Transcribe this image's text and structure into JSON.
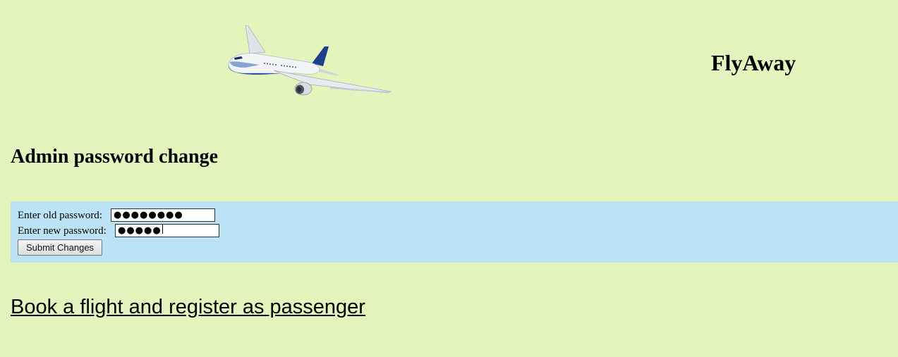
{
  "header": {
    "logo_icon": "airplane-icon",
    "brand": "FlyAway"
  },
  "page": {
    "title": "Admin password change"
  },
  "form": {
    "old_password_label": "Enter old password:",
    "old_password_value": "●●●●●●●●",
    "new_password_label": "Enter new password:",
    "new_password_value": "●●●●●",
    "submit_label": "Submit Changes"
  },
  "links": {
    "book_flight": "Book a flight and register as passenger"
  },
  "colors": {
    "page_background": "#e3f5bd",
    "form_background": "#bce3f5"
  }
}
